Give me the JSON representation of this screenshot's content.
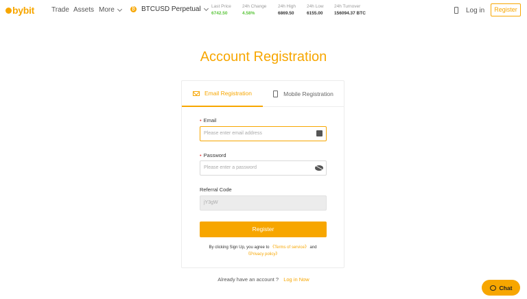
{
  "header": {
    "logo_text": "bybit",
    "nav": {
      "trade": "Trade",
      "assets": "Assets",
      "more": "More"
    },
    "pair": "BTCUSD Perpetual",
    "stats": [
      {
        "label": "Last Price",
        "value": "6742.50",
        "color": "#5ac53a"
      },
      {
        "label": "24h Change",
        "value": "4.58%",
        "color": "#5ac53a"
      },
      {
        "label": "24h High",
        "value": "6869.50",
        "color": "#333333"
      },
      {
        "label": "24h Low",
        "value": "6155.00",
        "color": "#333333"
      },
      {
        "label": "24h Turnover",
        "value": "156094.37 BTC",
        "color": "#333333"
      }
    ],
    "login": "Log in",
    "register": "Register"
  },
  "page": {
    "title": "Account Registration"
  },
  "tabs": {
    "email": "Email Registration",
    "mobile": "Mobile Registration"
  },
  "form": {
    "email_label": "Email",
    "email_placeholder": "Please enter email address",
    "password_label": "Password",
    "password_placeholder": "Please enter a password",
    "referral_label": "Referral Code",
    "referral_value": "jY3gW",
    "submit": "Register"
  },
  "terms": {
    "prefix": "By clicking Sign Up, you agree to",
    "terms_link": "《Terms of service》",
    "and": "and",
    "privacy_link": "《Privacy policy》"
  },
  "footer": {
    "already": "Already have an account ?",
    "login_link": "Log in Now"
  },
  "chat": {
    "label": "Chat"
  },
  "colors": {
    "accent": "#f7a600",
    "positive": "#5ac53a",
    "required": "#e63e3e"
  }
}
